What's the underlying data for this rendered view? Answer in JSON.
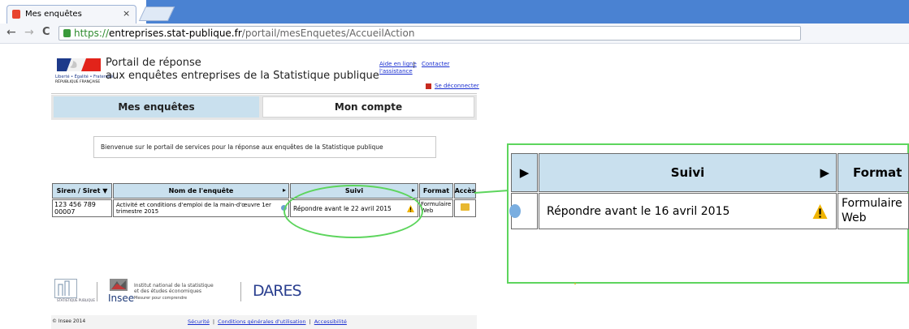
{
  "browser": {
    "tab_title": "Mes enquêtes",
    "tab_close": "×",
    "url_scheme": "https://",
    "url_host": "entreprises.stat-publique.fr",
    "url_path": "/portail/mesEnquetes/AccueilAction",
    "nav_back": "←",
    "nav_forward": "→",
    "nav_reload": "C"
  },
  "header": {
    "logo_text1": "Liberté • Égalité • Fraternité",
    "logo_text2": "RÉPUBLIQUE FRANÇAISE",
    "title_line1": "Portail de réponse",
    "title_line2": "aux enquêtes entreprises de la Statistique publique",
    "help_link": "Aide en ligne",
    "contact_link_1": "Contacter",
    "contact_link_2": "l'assistance",
    "separator": "|",
    "logout_link": "Se déconnecter"
  },
  "tabs": {
    "enquetes": "Mes enquêtes",
    "compte": "Mon compte"
  },
  "welcome": "Bienvenue sur le portail de services pour la réponse aux enquêtes de la Statistique publique",
  "table": {
    "headers": [
      "Siren / Siret ▼",
      "Nom de l'enquête",
      "Suivi",
      "Format",
      "Accès"
    ],
    "arrow": "▸",
    "row": {
      "siret": "123 456 789 00007",
      "nom": "Activité et conditions d'emploi de la main-d'œuvre 1er trimestre 2015",
      "suivi": "Répondre avant le 22 avril 2015",
      "format": "Formulaire Web"
    }
  },
  "zoom": {
    "arrow": "▶",
    "suivi_header": "Suivi",
    "format_header": "Format",
    "suivi_value": "Répondre avant le 16 avril 2015",
    "format_line1": "Formulaire",
    "format_line2": "Web"
  },
  "footer": {
    "ssp_text": "STATISTIQUE PUBLIQUE",
    "insee_line1": "Institut national de la statistique",
    "insee_line2": "et des études économiques",
    "insee_word": "Insee",
    "insee_tagline": "Mesurer pour comprendre",
    "dares": "DARES",
    "copyright": "© Insee 2014",
    "links": [
      "Sécurité",
      "Conditions générales d'utilisation",
      "Accessibilité"
    ],
    "link_separator": "|"
  },
  "colors": {
    "accent_blue": "#c9e0ee",
    "highlight_green": "#5dd55d",
    "link_blue": "#1a2fd0",
    "tab_strip": "#4a82d2"
  }
}
